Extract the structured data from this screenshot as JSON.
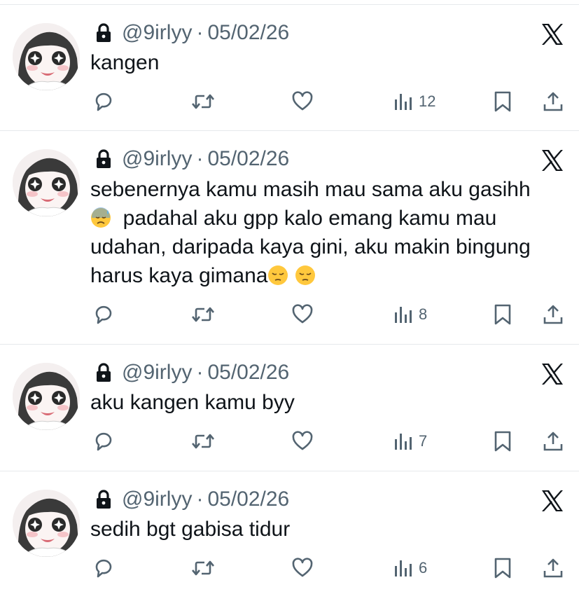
{
  "colors": {
    "text": "#0f1419",
    "muted": "#536471",
    "divider": "#e6e9ec"
  },
  "icons": {
    "lock": "lock-icon",
    "platform": "x-logo-icon",
    "reply": "reply-icon",
    "repost": "repost-icon",
    "like": "like-icon",
    "views": "views-icon",
    "bookmark": "bookmark-icon",
    "share": "share-icon"
  },
  "tweets": [
    {
      "handle": "@9irlyy",
      "separator": "·",
      "date": "05/02/26",
      "text": "kangen",
      "views": "12"
    },
    {
      "handle": "@9irlyy",
      "separator": "·",
      "date": "05/02/26",
      "text_line1": "sebenernya kamu masih mau sama aku gasihh",
      "emoji1": "😓",
      "text_line2": "padahal aku gpp kalo emang kamu mau",
      "text_line3": "udahan, daripada kaya gini, aku makin bingung",
      "text_line4": "harus kaya gimana",
      "emoji2": "😔",
      "emoji3": "😔",
      "views": "8"
    },
    {
      "handle": "@9irlyy",
      "separator": "·",
      "date": "05/02/26",
      "text": "aku kangen kamu byy",
      "views": "7"
    },
    {
      "handle": "@9irlyy",
      "separator": "·",
      "date": "05/02/26",
      "text": "sedih bgt gabisa tidur",
      "views": "6"
    }
  ]
}
